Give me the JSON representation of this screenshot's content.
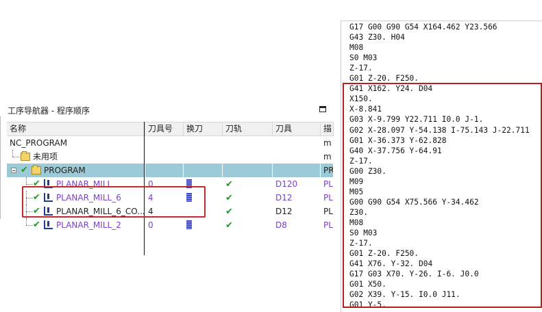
{
  "navigator": {
    "title": "工序导航器 - 程序顺序",
    "columns": [
      "名称",
      "刀具号",
      "换刀",
      "刀轨",
      "刀具",
      "描"
    ],
    "rows": [
      {
        "name": "NC_PROGRAM",
        "toolno": "",
        "toolchange": false,
        "path": false,
        "tool": "",
        "desc": "m"
      },
      {
        "name": "未用项",
        "toolno": "",
        "toolchange": false,
        "path": false,
        "tool": "",
        "desc": "m"
      },
      {
        "name": "PROGRAM",
        "toolno": "",
        "toolchange": false,
        "path": false,
        "tool": "",
        "desc": "PR"
      },
      {
        "name": "PLANAR_MILL",
        "toolno": "0",
        "toolchange": true,
        "path": true,
        "tool": "D120",
        "desc": "PL"
      },
      {
        "name": "PLANAR_MILL_6",
        "toolno": "4",
        "toolchange": true,
        "path": true,
        "tool": "D12",
        "desc": "PL"
      },
      {
        "name": "PLANAR_MILL_6_CO...",
        "toolno": "4",
        "toolchange": false,
        "path": true,
        "tool": "D12",
        "desc": "PL"
      },
      {
        "name": "PLANAR_MILL_2",
        "toolno": "0",
        "toolchange": true,
        "path": true,
        "tool": "D8",
        "desc": "PL"
      }
    ]
  },
  "nc_code": [
    "G17 G00 G90 G54 X164.462 Y23.566",
    "G43 Z30. H04",
    "M08",
    "S0 M03",
    "Z-17.",
    "G01 Z-20. F250.",
    "G41 X162. Y24. D04",
    "X150.",
    "X-8.841",
    "G03 X-9.799 Y22.711 I0.0 J-1.",
    "G02 X-28.097 Y-54.138 I-75.143 J-22.711",
    "G01 X-36.373 Y-62.828",
    "G40 X-37.756 Y-64.91",
    "Z-17.",
    "G00 Z30.",
    "M09",
    "M05",
    "G00 G90 G54 X75.566 Y-34.462",
    "Z30.",
    "M08",
    "S0 M03",
    "Z-17.",
    "G01 Z-20. F250.",
    "G41 X76. Y-32. D04",
    "G17 G03 X70. Y-26. I-6. J0.0",
    "G01 X50.",
    "G02 X39. Y-15. I0.0 J11.",
    "G01 Y-5."
  ],
  "colors": {
    "highlight": "#9ccbd7",
    "annotation": "#c42828",
    "op_text": "#7a3fd0",
    "check": "#19a019"
  }
}
